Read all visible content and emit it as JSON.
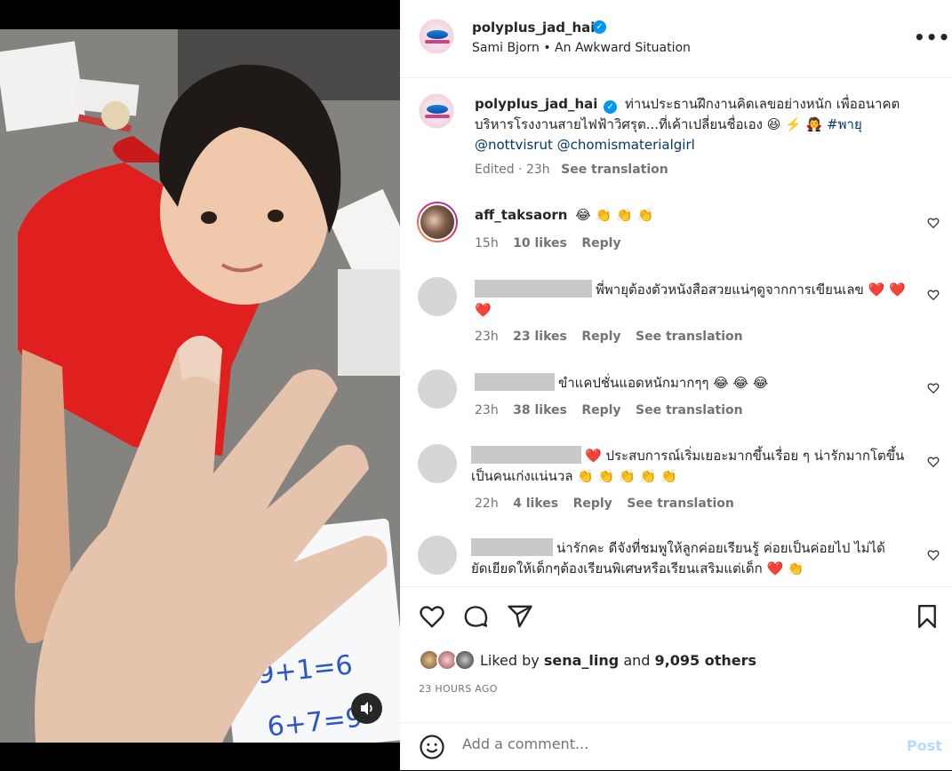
{
  "post": {
    "username": "polyplus_jad_hai",
    "audio": "Sami Bjorn • An Awkward Situation",
    "caption": {
      "text": "ท่านประธานฝึกงานคิดเลขอย่างหนัก เพื่ออนาคตบริหารโรงงานสายไฟฟ้าวิศรุต...ที่เค้าเปลี่ยนชื่อเอง 😆 ⚡️ 🧛 ",
      "hashtag": "#พายุ",
      "mentions": "@nottvisrut @chomismaterialgirl",
      "edited": "Edited · 23h",
      "see_translation": "See translation"
    },
    "comments": [
      {
        "username": "aff_taksaorn",
        "text": "😂 👏 👏 👏",
        "time": "15h",
        "likes": "10 likes",
        "reply": "Reply",
        "see_translation": ""
      },
      {
        "username": "",
        "text": "พี่พายุต้องตัวหนังสือสวยแน่ๆดูจากการเขียนเลข ❤️ ❤️ ❤️",
        "time": "23h",
        "likes": "23 likes",
        "reply": "Reply",
        "see_translation": "See translation"
      },
      {
        "username": "",
        "text": "ขำแคปชั่นแอดหนักมากๆๆ 😂 😂 😂",
        "time": "23h",
        "likes": "38 likes",
        "reply": "Reply",
        "see_translation": "See translation"
      },
      {
        "username": "",
        "text": "❤️ ประสบการณ์เริ่มเยอะมากขึ้นเรื่อย ๆ น่ารักมากโตขึ้นเป็นคนเก่งแน่นวล 👏 👏 👏 👏 👏",
        "time": "22h",
        "likes": "4 likes",
        "reply": "Reply",
        "see_translation": "See translation"
      },
      {
        "username": "",
        "text": "น่ารักคะ ดีจังที่ชมพูให้ลูกค่อยเรียนรู้ ค่อยเป็นค่อยไป ไม่ได้ยัดเยียดให้เด็กๆต้องเรียนพิเศษหรือเรียนเสริมแต่เด็ก ❤️ 👏",
        "time": "",
        "likes": "",
        "reply": "",
        "see_translation": ""
      }
    ],
    "liked_by_prefix": "Liked by",
    "liked_by_user": "sena_ling",
    "liked_by_and": "and",
    "liked_by_count": "9,095 others",
    "timestamp": "23 HOURS AGO",
    "add_comment_placeholder": "Add a comment...",
    "post_button": "Post",
    "icons": [
      "heart-icon",
      "comment-icon",
      "share-icon",
      "bookmark-icon",
      "emoji-icon",
      "more-icon",
      "volume-icon",
      "verified-icon"
    ]
  },
  "colors": {
    "verified": "#0095f6",
    "link": "#00376b",
    "post_button_disabled": "#b3dbff",
    "meta": "#737373"
  }
}
